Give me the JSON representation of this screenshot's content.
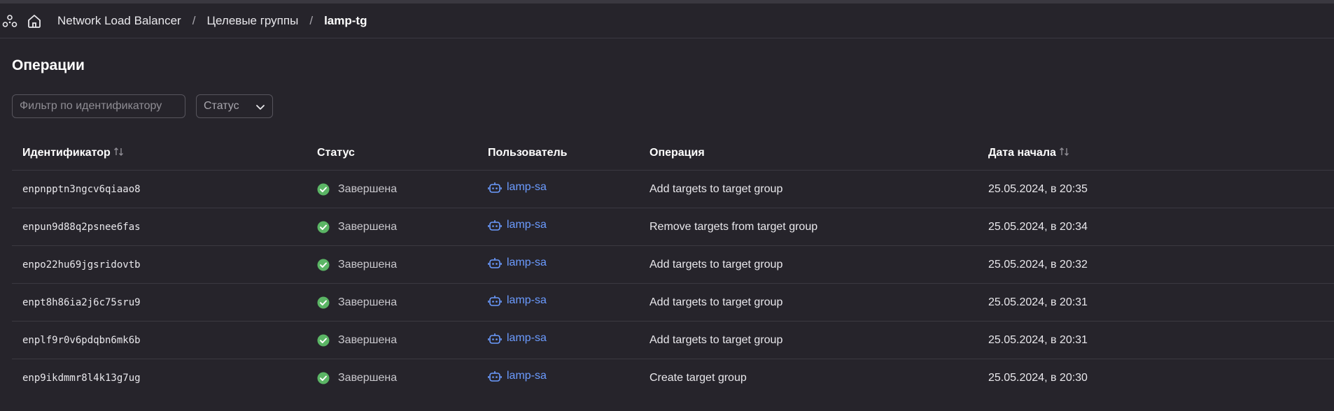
{
  "header": {
    "breadcrumbs": [
      "Network Load Balancer",
      "Целевые группы"
    ],
    "current": "lamp-tg",
    "separator": "/"
  },
  "page": {
    "title": "Операции"
  },
  "filters": {
    "id_placeholder": "Фильтр по идентификатору",
    "status_label": "Статус"
  },
  "table": {
    "columns": {
      "id": "Идентификатор",
      "status": "Статус",
      "user": "Пользователь",
      "operation": "Операция",
      "date": "Дата начала"
    },
    "rows": [
      {
        "id": "enpnpptn3ngcv6qiaao8",
        "status": "Завершена",
        "user": "lamp-sa",
        "operation": "Add targets to target group",
        "date": "25.05.2024, в 20:35"
      },
      {
        "id": "enpun9d88q2psnee6fas",
        "status": "Завершена",
        "user": "lamp-sa",
        "operation": "Remove targets from target group",
        "date": "25.05.2024, в 20:34"
      },
      {
        "id": "enpo22hu69jgsridovtb",
        "status": "Завершена",
        "user": "lamp-sa",
        "operation": "Add targets to target group",
        "date": "25.05.2024, в 20:32"
      },
      {
        "id": "enpt8h86ia2j6c75sru9",
        "status": "Завершена",
        "user": "lamp-sa",
        "operation": "Add targets to target group",
        "date": "25.05.2024, в 20:31"
      },
      {
        "id": "enplf9r0v6pdqbn6mk6b",
        "status": "Завершена",
        "user": "lamp-sa",
        "operation": "Add targets to target group",
        "date": "25.05.2024, в 20:31"
      },
      {
        "id": "enp9ikdmmr8l4k13g7ug",
        "status": "Завершена",
        "user": "lamp-sa",
        "operation": "Create target group",
        "date": "25.05.2024, в 20:30"
      }
    ]
  },
  "icons": {
    "services": "services-icon",
    "home": "home-icon",
    "chevron": "chevron-down-icon",
    "sort": "sort-icon",
    "status_done": "check-circle-icon",
    "user": "robot-icon"
  },
  "colors": {
    "background": "#26242b",
    "link": "#6b9bff",
    "success": "#5bb565",
    "border": "#3b3941"
  }
}
